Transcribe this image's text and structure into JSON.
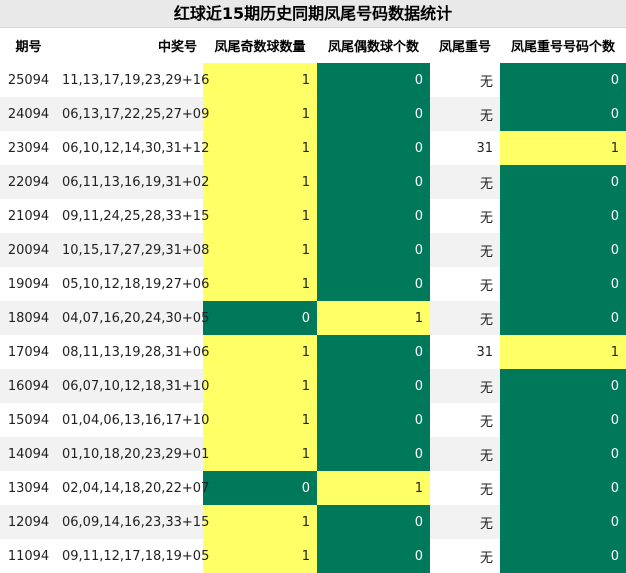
{
  "title": "红球近15期历史同期凤尾号码数据统计",
  "headers": [
    "期号",
    "中奖号",
    "凤尾奇数球数量",
    "凤尾偶数球个数",
    "凤尾重号",
    "凤尾重号号码个数"
  ],
  "colors": {
    "highlight": "#ffff66",
    "accent": "#00785a",
    "header_bg": "#e9e9e9"
  },
  "rows": [
    {
      "period": "25094",
      "numbers": "11,13,17,19,23,29+16",
      "odd": "1",
      "even": "0",
      "repeat": "无",
      "repeat_count": "0"
    },
    {
      "period": "24094",
      "numbers": "06,13,17,22,25,27+09",
      "odd": "1",
      "even": "0",
      "repeat": "无",
      "repeat_count": "0"
    },
    {
      "period": "23094",
      "numbers": "06,10,12,14,30,31+12",
      "odd": "1",
      "even": "0",
      "repeat": "31",
      "repeat_count": "1"
    },
    {
      "period": "22094",
      "numbers": "06,11,13,16,19,31+02",
      "odd": "1",
      "even": "0",
      "repeat": "无",
      "repeat_count": "0"
    },
    {
      "period": "21094",
      "numbers": "09,11,24,25,28,33+15",
      "odd": "1",
      "even": "0",
      "repeat": "无",
      "repeat_count": "0"
    },
    {
      "period": "20094",
      "numbers": "10,15,17,27,29,31+08",
      "odd": "1",
      "even": "0",
      "repeat": "无",
      "repeat_count": "0"
    },
    {
      "period": "19094",
      "numbers": "05,10,12,18,19,27+06",
      "odd": "1",
      "even": "0",
      "repeat": "无",
      "repeat_count": "0"
    },
    {
      "period": "18094",
      "numbers": "04,07,16,20,24,30+05",
      "odd": "0",
      "even": "1",
      "repeat": "无",
      "repeat_count": "0"
    },
    {
      "period": "17094",
      "numbers": "08,11,13,19,28,31+06",
      "odd": "1",
      "even": "0",
      "repeat": "31",
      "repeat_count": "1"
    },
    {
      "period": "16094",
      "numbers": "06,07,10,12,18,31+10",
      "odd": "1",
      "even": "0",
      "repeat": "无",
      "repeat_count": "0"
    },
    {
      "period": "15094",
      "numbers": "01,04,06,13,16,17+10",
      "odd": "1",
      "even": "0",
      "repeat": "无",
      "repeat_count": "0"
    },
    {
      "period": "14094",
      "numbers": "01,10,18,20,23,29+01",
      "odd": "1",
      "even": "0",
      "repeat": "无",
      "repeat_count": "0"
    },
    {
      "period": "13094",
      "numbers": "02,04,14,18,20,22+07",
      "odd": "0",
      "even": "1",
      "repeat": "无",
      "repeat_count": "0"
    },
    {
      "period": "12094",
      "numbers": "06,09,14,16,23,33+15",
      "odd": "1",
      "even": "0",
      "repeat": "无",
      "repeat_count": "0"
    },
    {
      "period": "11094",
      "numbers": "09,11,12,17,18,19+05",
      "odd": "1",
      "even": "0",
      "repeat": "无",
      "repeat_count": "0"
    }
  ]
}
